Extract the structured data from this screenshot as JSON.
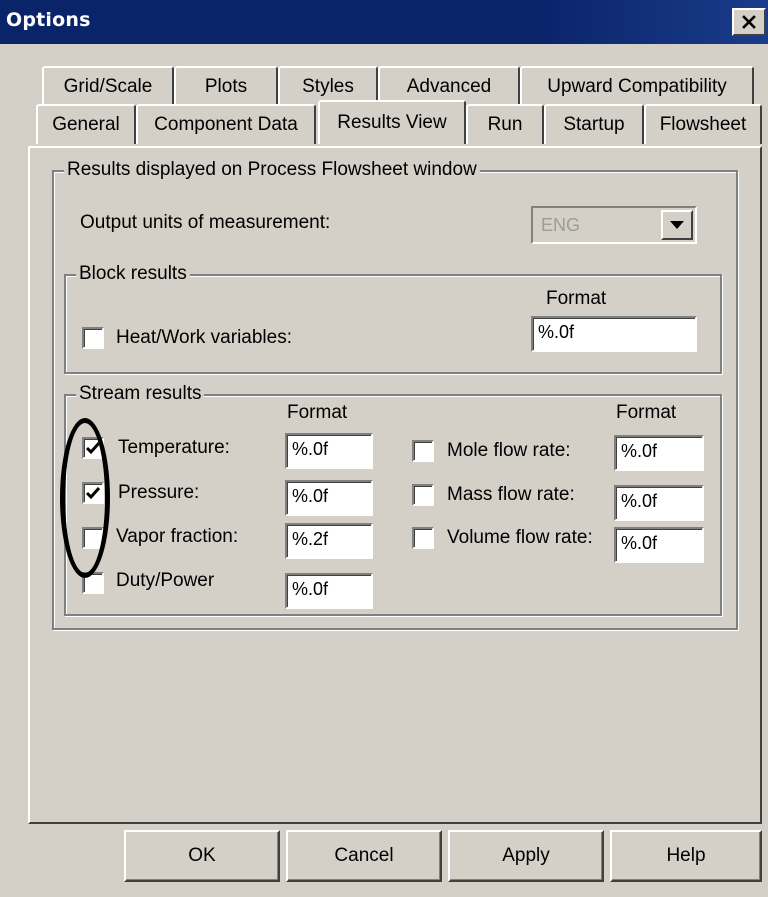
{
  "window": {
    "title": "Options",
    "close_glyph": "✕"
  },
  "tabs": {
    "row1": [
      "Grid/Scale",
      "Plots",
      "Styles",
      "Advanced",
      "Upward Compatibility"
    ],
    "row2": [
      "General",
      "Component Data",
      "Results View",
      "Run",
      "Startup",
      "Flowsheet"
    ],
    "active": "Results View"
  },
  "results_group": {
    "legend": "Results displayed on Process Flowsheet window",
    "units_label": "Output units of measurement:",
    "units_value": "ENG",
    "units_icon": "chevron-down-icon"
  },
  "block_results": {
    "legend": "Block results",
    "format_header": "Format",
    "heat_work": {
      "label": "Heat/Work variables:",
      "checked": false,
      "format": "%.0f"
    }
  },
  "stream_results": {
    "legend": "Stream results",
    "format_header_left": "Format",
    "format_header_right": "Format",
    "temperature": {
      "label": "Temperature:",
      "checked": true,
      "format": "%.0f"
    },
    "pressure": {
      "label": "Pressure:",
      "checked": true,
      "format": "%.0f"
    },
    "vapor_fraction": {
      "label": "Vapor fraction:",
      "checked": false,
      "format": "%.2f"
    },
    "duty_power": {
      "label": "Duty/Power",
      "checked": false,
      "format": "%.0f"
    },
    "mole_flow": {
      "label": "Mole flow rate:",
      "checked": false,
      "format": "%.0f"
    },
    "mass_flow": {
      "label": "Mass flow rate:",
      "checked": false,
      "format": "%.0f"
    },
    "volume_flow": {
      "label": "Volume flow rate:",
      "checked": false,
      "format": "%.0f"
    }
  },
  "buttons": {
    "ok": "OK",
    "cancel": "Cancel",
    "apply": "Apply",
    "help": "Help"
  }
}
